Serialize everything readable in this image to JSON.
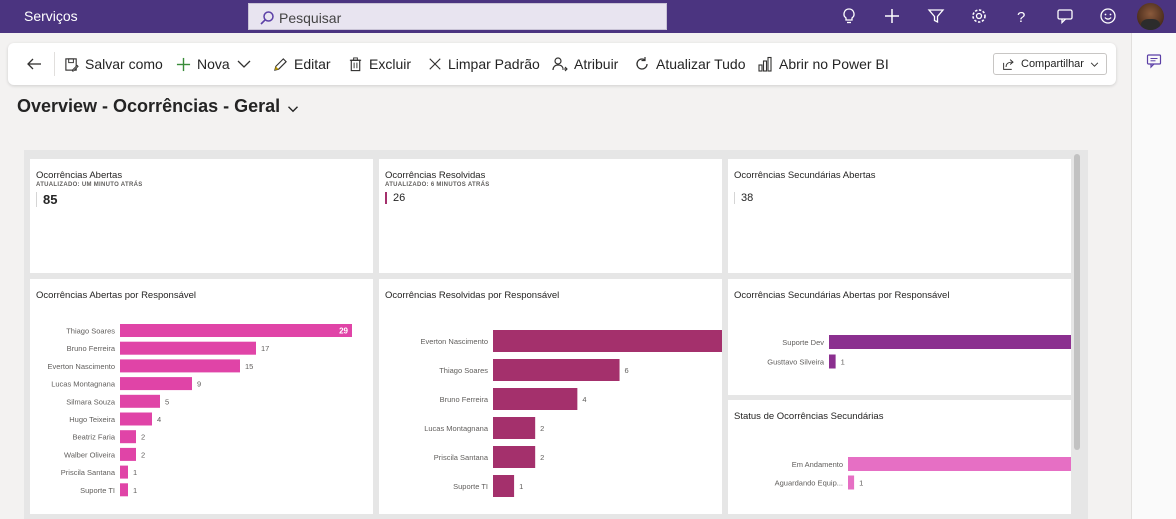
{
  "app": {
    "title": "Serviços",
    "search_placeholder": "Pesquisar"
  },
  "toolbar": {
    "save_as": "Salvar como",
    "new": "Nova",
    "edit": "Editar",
    "delete": "Excluir",
    "clear_default": "Limpar Padrão",
    "assign": "Atribuir",
    "refresh_all": "Atualizar Tudo",
    "open_power_bi": "Abrir no Power BI",
    "share": "Compartilhar"
  },
  "page": {
    "title": "Overview - Ocorrências - Geral"
  },
  "kpis": [
    {
      "title": "Ocorrências Abertas",
      "updated": "ATUALIZADO: UM MINUTO ATRÁS",
      "value": "85"
    },
    {
      "title": "Ocorrências Resolvidas",
      "updated": "ATUALIZADO: 6 MINUTOS ATRÁS",
      "value": "26"
    },
    {
      "title": "Ocorrências Secundárias Abertas",
      "updated": "",
      "value": "38"
    }
  ],
  "colors": {
    "topbar": "#4b3480",
    "chart_open": "#e044a7",
    "chart_resolved": "#a4306c",
    "chart_secondary": "#8b2f8f",
    "chart_status": "#e66fc4"
  },
  "chart_data": [
    {
      "type": "bar",
      "orientation": "horizontal",
      "title": "Ocorrências Abertas por Responsável",
      "categories": [
        "Thiago Soares",
        "Bruno Ferreira",
        "Everton Nascimento",
        "Lucas Montagnana",
        "Silmara Souza",
        "Hugo Teixeira",
        "Beatriz Faria",
        "Walber Oliveira",
        "Priscila Santana",
        "Suporte TI"
      ],
      "values": [
        29,
        17,
        15,
        9,
        5,
        4,
        2,
        2,
        1,
        1
      ]
    },
    {
      "type": "bar",
      "orientation": "horizontal",
      "title": "Ocorrências Resolvidas por Responsável",
      "categories": [
        "Everton Nascimento",
        "Thiago Soares",
        "Bruno Ferreira",
        "Lucas Montagnana",
        "Priscila Santana",
        "Suporte TI"
      ],
      "values": [
        11,
        6,
        4,
        2,
        2,
        1
      ]
    },
    {
      "type": "bar",
      "orientation": "horizontal",
      "title": "Ocorrências Secundárias Abertas por Responsável",
      "categories": [
        "Suporte Dev",
        "Gusttavo Silveira"
      ],
      "values": [
        37,
        1
      ]
    },
    {
      "type": "bar",
      "orientation": "horizontal",
      "title": "Status de Ocorrências Secundárias",
      "categories": [
        "Em Andamento",
        "Aguardando Equip..."
      ],
      "values": [
        37,
        1
      ]
    }
  ]
}
